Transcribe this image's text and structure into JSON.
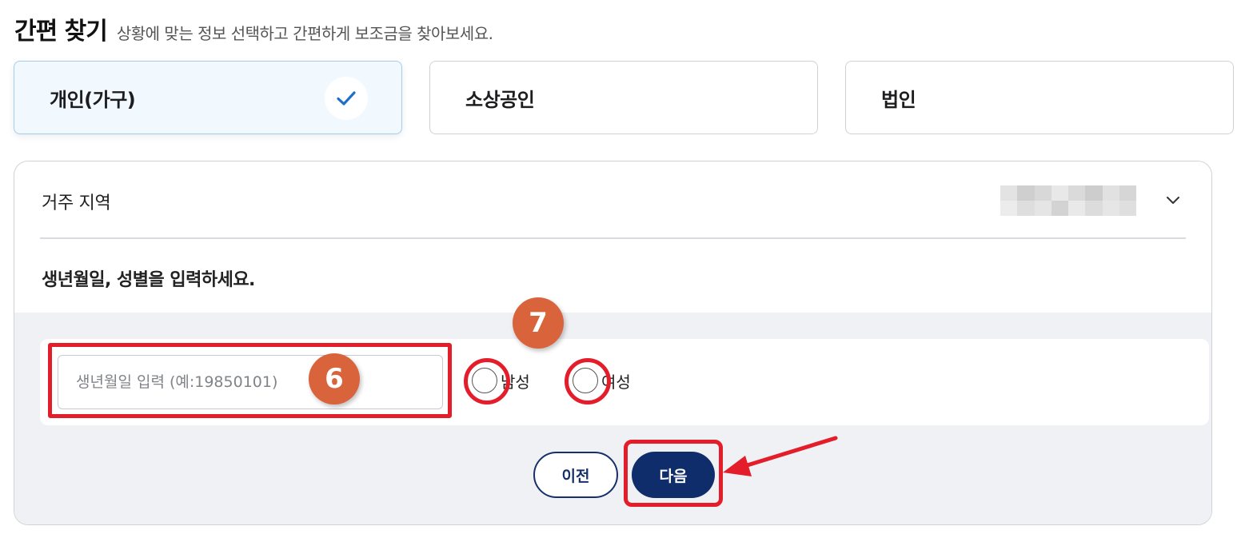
{
  "header": {
    "title": "간편 찾기",
    "subtitle": "상황에 맞는 정보 선택하고 간편하게 보조금을 찾아보세요."
  },
  "types": [
    {
      "label": "개인(가구)",
      "selected": true
    },
    {
      "label": "소상공인",
      "selected": false
    },
    {
      "label": "법인",
      "selected": false
    }
  ],
  "region": {
    "label": "거주 지역",
    "value_icon": "blurred-pixelated-value",
    "chevron_icon": "chevron-down-icon"
  },
  "form": {
    "prompt": "생년월일, 성별을 입력하세요.",
    "birth_placeholder": "생년월일 입력 (예:19850101)",
    "birth_value": "",
    "gender_options": [
      "남성",
      "여성"
    ]
  },
  "buttons": {
    "prev_label": "이전",
    "next_label": "다음"
  },
  "annotations": {
    "badge_birth": "6",
    "badge_gender": "7",
    "highlight_color": "#e41d2b",
    "badge_color": "#d9633b"
  },
  "colors": {
    "accent_navy": "#0f2d6b",
    "check_blue": "#1d6fc9",
    "selected_bg": "#f1f8fe",
    "panel_gray": "#eff1f5"
  }
}
